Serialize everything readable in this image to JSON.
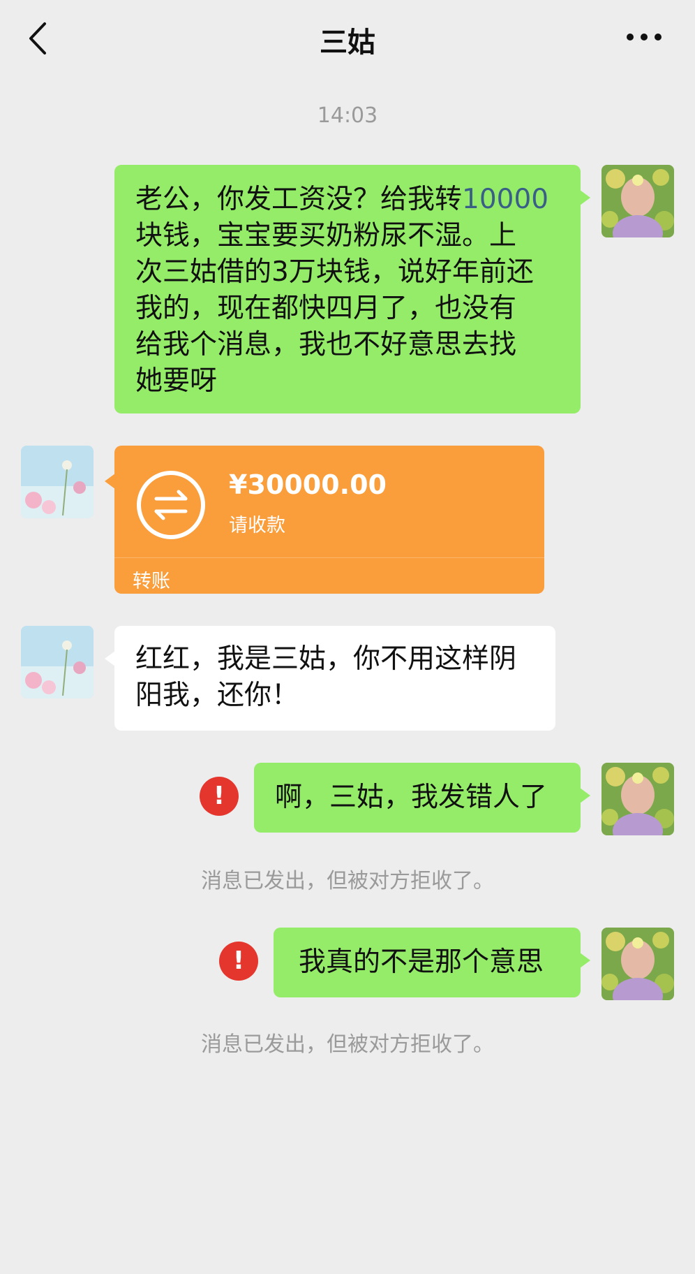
{
  "header": {
    "title": "三姑",
    "back_icon": "chevron-left-icon",
    "more_icon": "more-dots-icon"
  },
  "timestamp": "14:03",
  "messages": {
    "m1": {
      "sender": "me",
      "text_before": "老公，你发工资没？给我转",
      "highlight": "10000",
      "text_after": "块钱，宝宝要买奶粉尿不湿。上次三姑借的3万块钱，说好年前还我的，现在都快四月了，也没有给我个消息，我也不好意思去找她要呀",
      "lines": [
        "块钱，宝宝要买奶粉尿不湿。上",
        "次三姑借的3万块钱，说好年前还",
        "我的，现在都快四月了，也没有",
        "给我个消息，我也不好意思去找",
        "她要呀"
      ]
    },
    "m2": {
      "sender": "other",
      "type": "transfer",
      "amount": "¥30000.00",
      "note": "请收款",
      "label": "转账",
      "icon": "transfer-icon"
    },
    "m3": {
      "sender": "other",
      "lines": [
        "红红，我是三姑，你不用这样阴",
        "阳我，还你！"
      ]
    },
    "m4": {
      "sender": "me",
      "text": "啊，三姑，我发错人了",
      "status": "failed",
      "status_icon": "!"
    },
    "m5": {
      "sender": "me",
      "text": "我真的不是那个意思",
      "status": "failed",
      "status_icon": "!"
    }
  },
  "system": {
    "rejected_1": "消息已发出，但被对方拒收了。",
    "rejected_2": "消息已发出，但被对方拒收了。"
  },
  "colors": {
    "background": "#ededed",
    "my_bubble": "#95ec69",
    "transfer": "#fa9d3b",
    "error": "#e5362e",
    "highlight": "#3a5f86"
  }
}
